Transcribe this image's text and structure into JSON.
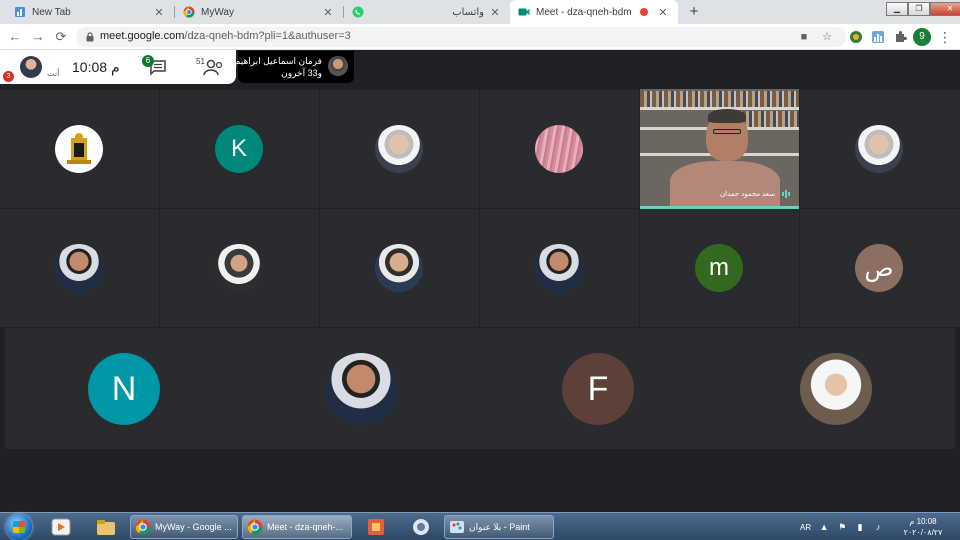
{
  "tabs": [
    {
      "label": "New Tab"
    },
    {
      "label": "MyWay"
    },
    {
      "label": "واتساب"
    },
    {
      "label": "Meet - dza-qneh-bdm"
    }
  ],
  "address": {
    "host": "meet.google.com",
    "path": "/dza-qneh-bdm?pli=1&authuser=3"
  },
  "profile_initial": "9",
  "meet": {
    "self_badge": "3",
    "self_label": "أنت",
    "time": "10:08 م",
    "chat_count": "6",
    "people_count": "51",
    "presenter_line1": "فرمان اسماعيل ابراهيم",
    "presenter_line2": "و33 آخرون"
  },
  "participants": {
    "k": "K",
    "m": "m",
    "sad": "ص",
    "n": "N",
    "f": "F",
    "video_name": "سعد محمود حمدان"
  },
  "colors": {
    "k": "#00897b",
    "m": "#33691e",
    "sad": "#8d6e63",
    "n": "#0097a7",
    "f": "#5d4037",
    "active_speaker": "#5fd6c4"
  },
  "taskbar": {
    "tasks": [
      {
        "label": "MyWay - Google ..."
      },
      {
        "label": "Meet - dza-qneh-..."
      },
      {
        "label": "بلا عنوان - Paint"
      }
    ],
    "lang": "AR",
    "time": "10:08 م",
    "date": "٢٠٢٠/٠٨/٢٧"
  }
}
